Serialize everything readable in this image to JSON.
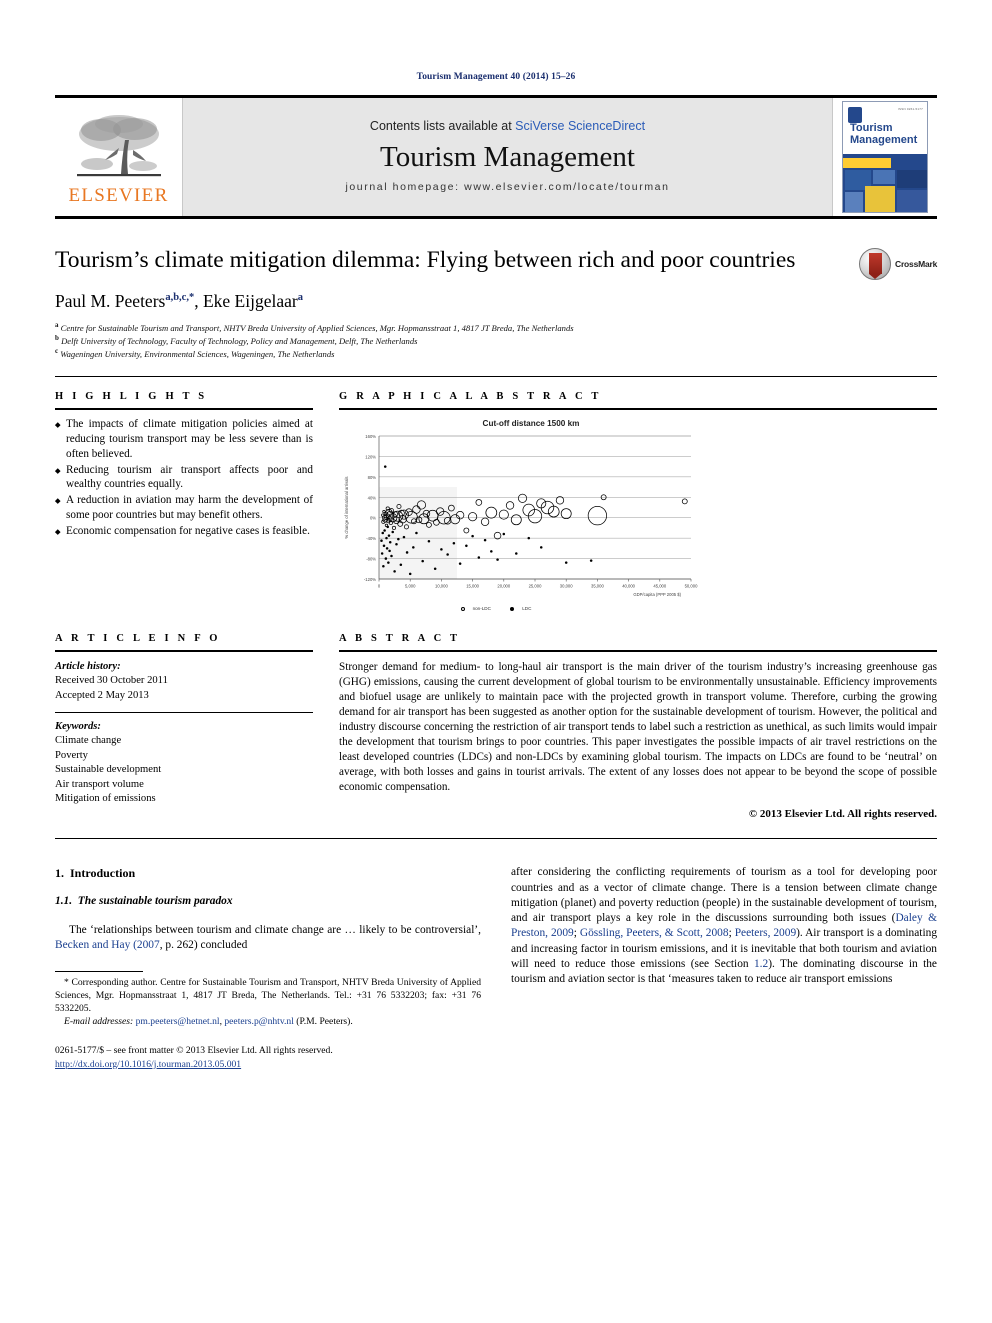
{
  "running_head": "Tourism Management 40 (2014) 15–26",
  "masthead": {
    "elsevier_wordmark": "ELSEVIER",
    "contents_prefix": "Contents lists available at ",
    "contents_link": "SciVerse ScienceDirect",
    "journal_name": "Tourism Management",
    "homepage": "journal homepage: www.elsevier.com/locate/tourman",
    "cover_title_line1": "Tourism",
    "cover_title_line2": "Management",
    "cover_tiny": "ISSN 0261-5177"
  },
  "title": "Tourism’s climate mitigation dilemma: Flying between rich and poor countries",
  "crossmark_label": "CrossMark",
  "authors": [
    {
      "name": "Paul M. Peeters",
      "sup": "a,b,c,*"
    },
    {
      "name": "Eke Eijgelaar",
      "sup": "a"
    }
  ],
  "affiliations": [
    {
      "mark": "a",
      "text": "Centre for Sustainable Tourism and Transport, NHTV Breda University of Applied Sciences, Mgr. Hopmansstraat 1, 4817 JT Breda, The Netherlands"
    },
    {
      "mark": "b",
      "text": "Delft University of Technology, Faculty of Technology, Policy and Management, Delft, The Netherlands"
    },
    {
      "mark": "c",
      "text": "Wageningen University, Environmental Sciences, Wageningen, The Netherlands"
    }
  ],
  "highlights": {
    "heading": "H I G H L I G H T S",
    "items": [
      "The impacts of climate mitigation policies aimed at reducing tourism transport may be less severe than is often believed.",
      "Reducing tourism air transport affects poor and wealthy countries equally.",
      "A reduction in aviation may harm the development of some poor countries but may benefit others.",
      "Economic compensation for negative cases is feasible."
    ]
  },
  "graphical_abstract": {
    "heading": "G R A P H I C A L   A B S T R A C T"
  },
  "chart_data": {
    "type": "scatter",
    "title": "Cut-off distance 1500 km",
    "xlabel": "GDP/capita (PPP 2005 $)",
    "ylabel": "% change of international arrivals",
    "xlim": [
      0,
      50000
    ],
    "ylim": [
      -120,
      160
    ],
    "xticks": [
      "0",
      "5,000",
      "10,000",
      "15,000",
      "20,000",
      "25,000",
      "30,000",
      "35,000",
      "40,000",
      "45,000",
      "50,000"
    ],
    "yticks": [
      "160%",
      "120%",
      "80%",
      "40%",
      "0%",
      "-40%",
      "-80%",
      "-120%"
    ],
    "grid": true,
    "legend_position": "bottom",
    "legend": [
      {
        "name": "non-LDC",
        "marker": "open-circle"
      },
      {
        "name": "LDC",
        "marker": "filled-circle"
      }
    ],
    "series": [
      {
        "name": "non-LDC",
        "points": [
          [
            600,
            5,
            3
          ],
          [
            700,
            -8,
            4
          ],
          [
            800,
            12,
            3
          ],
          [
            900,
            0,
            5
          ],
          [
            1000,
            -4,
            6
          ],
          [
            1100,
            8,
            4
          ],
          [
            1200,
            -15,
            3
          ],
          [
            1300,
            2,
            7
          ],
          [
            1400,
            18,
            4
          ],
          [
            1500,
            -6,
            5
          ],
          [
            1600,
            10,
            8
          ],
          [
            1700,
            -2,
            6
          ],
          [
            1800,
            5,
            9
          ],
          [
            1900,
            -10,
            4
          ],
          [
            2000,
            14,
            5
          ],
          [
            2200,
            0,
            10
          ],
          [
            2400,
            -20,
            4
          ],
          [
            2600,
            7,
            6
          ],
          [
            2800,
            -5,
            8
          ],
          [
            3000,
            3,
            12
          ],
          [
            3200,
            22,
            5
          ],
          [
            3400,
            -12,
            6
          ],
          [
            3600,
            9,
            7
          ],
          [
            3800,
            -3,
            9
          ],
          [
            4000,
            6,
            11
          ],
          [
            4400,
            -18,
            5
          ],
          [
            4800,
            11,
            8
          ],
          [
            5200,
            1,
            14
          ],
          [
            5600,
            -7,
            6
          ],
          [
            6000,
            16,
            9
          ],
          [
            6400,
            -4,
            7
          ],
          [
            6800,
            25,
            10
          ],
          [
            7200,
            -2,
            12
          ],
          [
            7600,
            8,
            8
          ],
          [
            8000,
            -14,
            6
          ],
          [
            8600,
            4,
            13
          ],
          [
            9200,
            -9,
            7
          ],
          [
            9800,
            12,
            9
          ],
          [
            10400,
            0,
            15
          ],
          [
            11000,
            -6,
            8
          ],
          [
            11600,
            19,
            7
          ],
          [
            12200,
            -3,
            11
          ],
          [
            13000,
            5,
            9
          ],
          [
            14000,
            -25,
            6
          ],
          [
            15000,
            2,
            10
          ],
          [
            16000,
            30,
            7
          ],
          [
            17000,
            -8,
            9
          ],
          [
            18000,
            10,
            13
          ],
          [
            19000,
            -35,
            8
          ],
          [
            20000,
            6,
            11
          ],
          [
            21000,
            24,
            9
          ],
          [
            22000,
            -4,
            12
          ],
          [
            23000,
            38,
            10
          ],
          [
            24000,
            15,
            14
          ],
          [
            25000,
            3,
            16
          ],
          [
            26000,
            28,
            11
          ],
          [
            27000,
            20,
            15
          ],
          [
            28000,
            12,
            13
          ],
          [
            29000,
            34,
            9
          ],
          [
            30000,
            8,
            12
          ],
          [
            35000,
            4,
            22
          ],
          [
            36000,
            40,
            6
          ],
          [
            49000,
            32,
            6
          ]
        ]
      },
      {
        "name": "LDC",
        "points": [
          [
            400,
            -45,
            3
          ],
          [
            500,
            -70,
            3
          ],
          [
            600,
            -30,
            3
          ],
          [
            700,
            -95,
            3
          ],
          [
            800,
            -55,
            3
          ],
          [
            900,
            -25,
            3
          ],
          [
            1000,
            100,
            3
          ],
          [
            1100,
            -80,
            3
          ],
          [
            1200,
            -40,
            3
          ],
          [
            1300,
            -60,
            3
          ],
          [
            1400,
            -18,
            3
          ],
          [
            1500,
            -88,
            3
          ],
          [
            1600,
            -35,
            3
          ],
          [
            1700,
            -65,
            3
          ],
          [
            1800,
            -48,
            3
          ],
          [
            2000,
            -75,
            3
          ],
          [
            2200,
            -28,
            3
          ],
          [
            2500,
            -105,
            3
          ],
          [
            2800,
            -52,
            3
          ],
          [
            3100,
            -42,
            3
          ],
          [
            3500,
            -92,
            3
          ],
          [
            4000,
            -38,
            3
          ],
          [
            4500,
            -68,
            3
          ],
          [
            5000,
            -110,
            3
          ],
          [
            5500,
            -58,
            3
          ],
          [
            6000,
            -30,
            3
          ],
          [
            7000,
            -85,
            3
          ],
          [
            8000,
            -46,
            3
          ],
          [
            9000,
            -100,
            3
          ],
          [
            10000,
            -62,
            3
          ],
          [
            11000,
            -72,
            3
          ],
          [
            12000,
            -50,
            3
          ],
          [
            13000,
            -90,
            3
          ],
          [
            14000,
            -55,
            3
          ],
          [
            15000,
            -36,
            3
          ],
          [
            16000,
            -78,
            3
          ],
          [
            17000,
            -44,
            3
          ],
          [
            18000,
            -66,
            3
          ],
          [
            19000,
            -82,
            3
          ],
          [
            20000,
            -32,
            3
          ],
          [
            22000,
            -70,
            3
          ],
          [
            24000,
            -40,
            3
          ],
          [
            26000,
            -58,
            3
          ],
          [
            30000,
            -88,
            3
          ],
          [
            34000,
            -84,
            3
          ]
        ]
      }
    ]
  },
  "article_info": {
    "heading": "A R T I C L E   I N F O",
    "history_label": "Article history:",
    "history": [
      "Received 30 October 2011",
      "Accepted 2 May 2013"
    ],
    "keywords_label": "Keywords:",
    "keywords": [
      "Climate change",
      "Poverty",
      "Sustainable development",
      "Air transport volume",
      "Mitigation of emissions"
    ]
  },
  "abstract": {
    "heading": "A B S T R A C T",
    "text": "Stronger demand for medium- to long-haul air transport is the main driver of the tourism industry’s increasing greenhouse gas (GHG) emissions, causing the current development of global tourism to be environmentally unsustainable. Efficiency improvements and biofuel usage are unlikely to maintain pace with the projected growth in transport volume. Therefore, curbing the growing demand for air transport has been suggested as another option for the sustainable development of tourism. However, the political and industry discourse concerning the restriction of air transport tends to label such a restriction as unethical, as such limits would impair the development that tourism brings to poor countries. This paper investigates the possible impacts of air travel restrictions on the least developed countries (LDCs) and non-LDCs by examining global tourism. The impacts on LDCs are found to be ‘neutral’ on average, with both losses and gains in tourist arrivals. The extent of any losses does not appear to be beyond the scope of possible economic compensation.",
    "copyright": "© 2013 Elsevier Ltd. All rights reserved."
  },
  "body": {
    "section_number": "1.",
    "section_title": "Introduction",
    "subsection_number": "1.1.",
    "subsection_title": "The sustainable tourism paradox",
    "left_para_pre": "The ‘relationships between tourism and climate change are … likely to be controversial’, ",
    "left_para_ref": "Becken and Hay (2007",
    "left_para_post": ", p. 262) concluded",
    "right_para": "after considering the conflicting requirements of tourism as a tool for developing poor countries and as a vector of climate change. There is a tension between climate change mitigation (planet) and poverty reduction (people) in the sustainable development of tourism, and air transport plays a key role in the discussions surrounding both issues (",
    "right_refs_1": "Daley & Preston, 2009",
    "right_mid_1": "; ",
    "right_refs_2": "Gössling, Peeters, & Scott, 2008",
    "right_mid_2": "; ",
    "right_refs_3": "Peeters, 2009",
    "right_para_2": "). Air transport is a dominating and increasing factor in tourism emissions, and it is inevitable that both tourism and aviation will need to reduce those emissions (see Section ",
    "right_ref_section": "1.2",
    "right_para_3": "). The dominating discourse in the tourism and aviation sector is that ‘measures taken to reduce air transport emissions"
  },
  "footnote": {
    "corresponding": "* Corresponding author. Centre for Sustainable Tourism and Transport, NHTV Breda University of Applied Sciences, Mgr. Hopmansstraat 1, 4817 JT Breda, The Netherlands. Tel.: +31 76 5332203; fax: +31 76 5332205.",
    "email_label": "E-mail addresses:",
    "email_1": "pm.peeters@hetnet.nl",
    "email_sep": ", ",
    "email_2": "peeters.p@nhtv.nl",
    "email_tail": " (P.M. Peeters)."
  },
  "frontmatter": {
    "line1": "0261-5177/$ – see front matter © 2013 Elsevier Ltd. All rights reserved.",
    "doi": "http://dx.doi.org/10.1016/j.tourman.2013.05.001"
  },
  "colors": {
    "link": "#1a3f8f",
    "elsevier_orange": "#e87722",
    "band_gray": "#e6e6e6",
    "cover_blue": "#24488c"
  }
}
